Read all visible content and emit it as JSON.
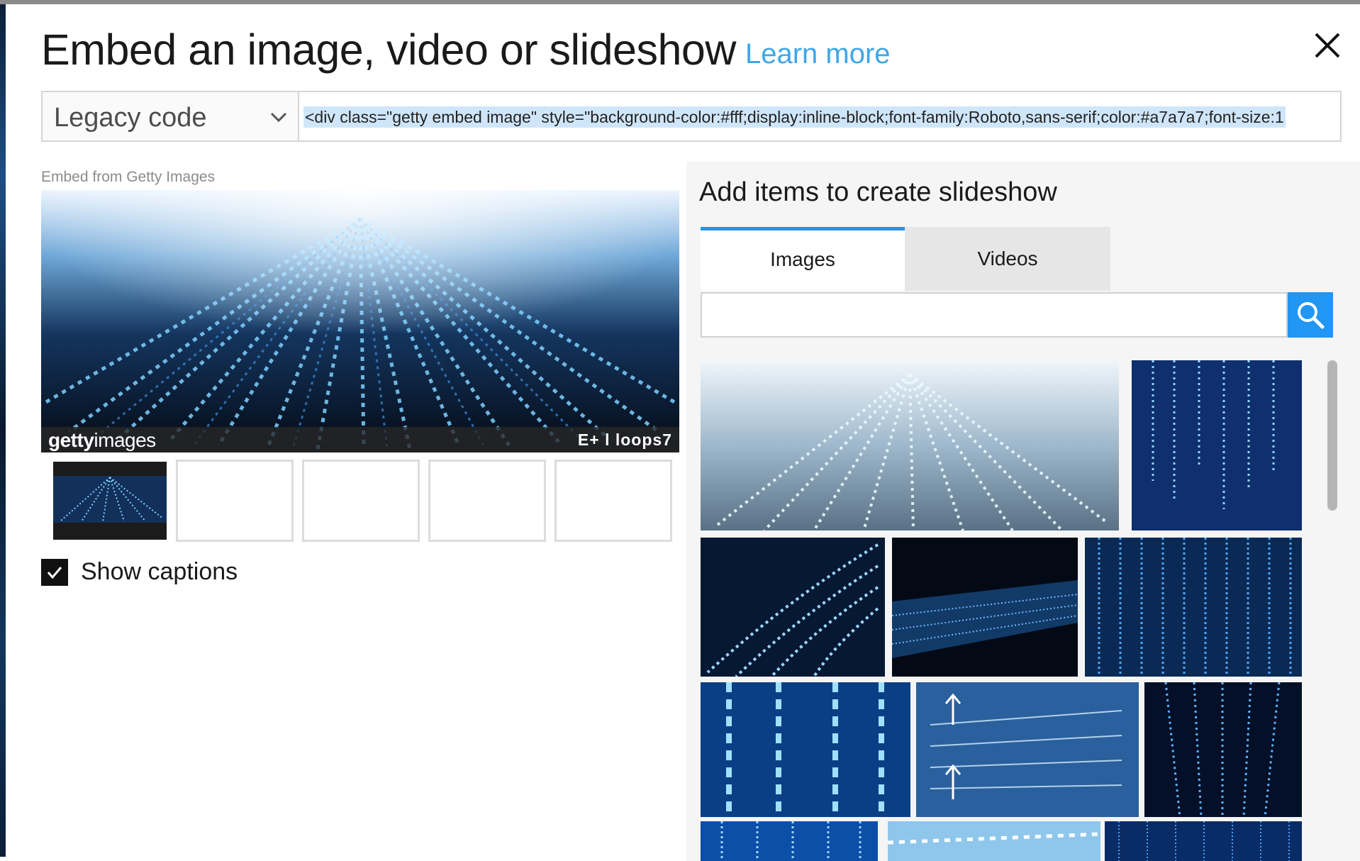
{
  "dialog": {
    "title": "Embed an image, video or slideshow",
    "learn_more": "Learn more",
    "close_icon": "close-icon"
  },
  "embed": {
    "format_selected": "Legacy code",
    "code": "<div class=\"getty embed image\" style=\"background-color:#fff;display:inline-block;font-family:Roboto,sans-serif;color:#a7a7a7;font-size:1"
  },
  "preview": {
    "label": "Embed from Getty Images",
    "brand_bold": "getty",
    "brand_regular": "images",
    "credit": "E+ l loops7",
    "show_captions_label": "Show captions",
    "show_captions_checked": true
  },
  "slideshow": {
    "title": "Add items to create slideshow",
    "tabs": [
      {
        "label": "Images",
        "active": true
      },
      {
        "label": "Videos",
        "active": false
      }
    ],
    "search_placeholder": "",
    "search_icon": "search-icon"
  },
  "colors": {
    "accent": "#2196f3",
    "link": "#3fa6e8"
  }
}
